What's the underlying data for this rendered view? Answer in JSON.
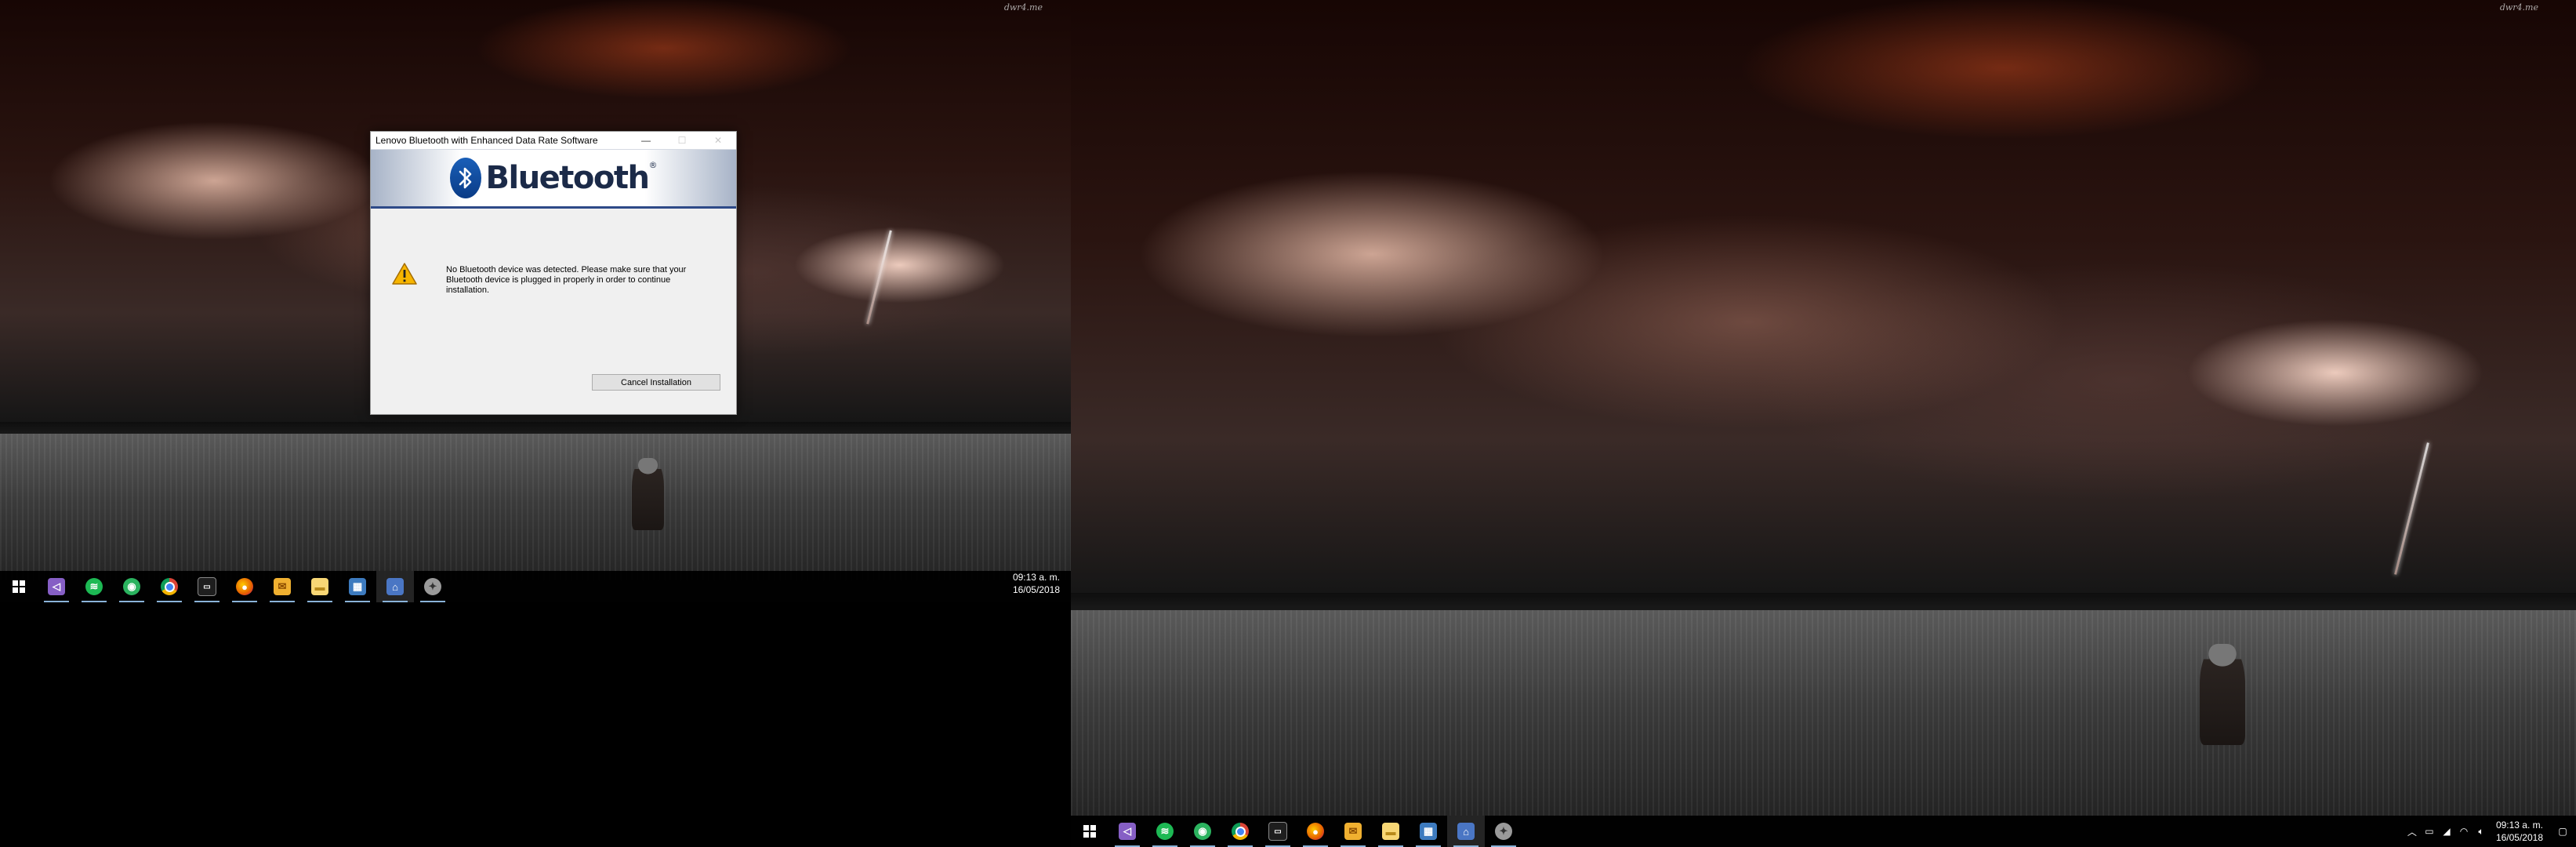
{
  "desktop": {
    "wallpaper_logo": "dwr4.me",
    "accent_color": "#8ab3d9"
  },
  "taskbar": {
    "apps": [
      {
        "name": "Visual Studio",
        "icon": "visual-studio-icon",
        "color": "#865fc5"
      },
      {
        "name": "Spotify",
        "icon": "spotify-icon",
        "color": "#1db954"
      },
      {
        "name": "Spotify",
        "icon": "spotify-green-icon",
        "color": "#2bb35f"
      },
      {
        "name": "Google Chrome",
        "icon": "chrome-icon",
        "color": "#f4b400"
      },
      {
        "name": "Command Prompt",
        "icon": "console-icon",
        "color": "#2b2b2b"
      },
      {
        "name": "Firefox",
        "icon": "firefox-icon",
        "color": "#e66000"
      },
      {
        "name": "Outlook",
        "icon": "mail-icon",
        "color": "#f0b030"
      },
      {
        "name": "File Explorer",
        "icon": "folder-icon",
        "color": "#f8d775"
      },
      {
        "name": "Control Panel",
        "icon": "control-panel-icon",
        "color": "#3d7bbf"
      },
      {
        "name": "Lenovo Bluetooth Installer",
        "icon": "installer-icon",
        "color": "#4a76c4"
      },
      {
        "name": "Bluetooth Setup",
        "icon": "setup-icon",
        "color": "#9a9a9a"
      }
    ],
    "clock_time": "09:13 a. m.",
    "clock_date": "16/05/2018"
  },
  "dialog": {
    "title": "Lenovo Bluetooth with Enhanced Data Rate Software",
    "banner_word": "Bluetooth",
    "banner_reg": "®",
    "message": "No Bluetooth device was detected. Please make sure that your Bluetooth device is plugged in properly in order to continue installation.",
    "cancel_label": "Cancel Installation",
    "minimize_glyph": "—",
    "maximize_glyph": "☐",
    "close_glyph": "✕"
  }
}
